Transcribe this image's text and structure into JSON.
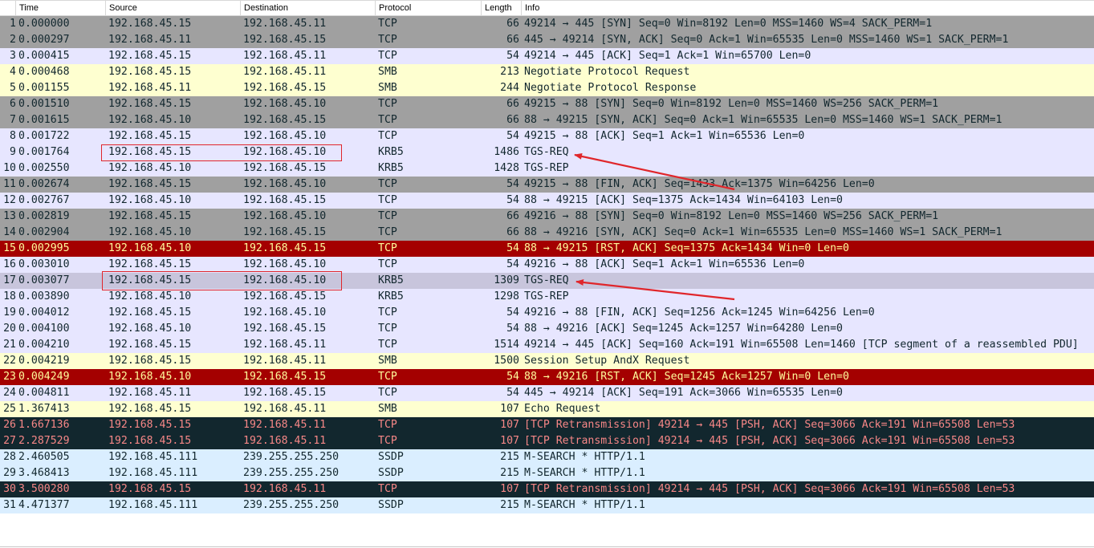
{
  "columns": {
    "no": "",
    "time": "Time",
    "source": "Source",
    "destination": "Destination",
    "protocol": "Protocol",
    "length": "Length",
    "info": "Info"
  },
  "packets": [
    {
      "no": "1",
      "time": "0.000000",
      "src": "192.168.45.15",
      "dst": "192.168.45.11",
      "proto": "TCP",
      "len": "66",
      "info": "49214 → 445 [SYN] Seq=0 Win=8192 Len=0 MSS=1460 WS=4 SACK_PERM=1",
      "style": "gray"
    },
    {
      "no": "2",
      "time": "0.000297",
      "src": "192.168.45.11",
      "dst": "192.168.45.15",
      "proto": "TCP",
      "len": "66",
      "info": "445 → 49214 [SYN, ACK] Seq=0 Ack=1 Win=65535 Len=0 MSS=1460 WS=1 SACK_PERM=1",
      "style": "gray"
    },
    {
      "no": "3",
      "time": "0.000415",
      "src": "192.168.45.15",
      "dst": "192.168.45.11",
      "proto": "TCP",
      "len": "54",
      "info": "49214 → 445 [ACK] Seq=1 Ack=1 Win=65700 Len=0",
      "style": "tcp"
    },
    {
      "no": "4",
      "time": "0.000468",
      "src": "192.168.45.15",
      "dst": "192.168.45.11",
      "proto": "SMB",
      "len": "213",
      "info": "Negotiate Protocol Request",
      "style": "smb"
    },
    {
      "no": "5",
      "time": "0.001155",
      "src": "192.168.45.11",
      "dst": "192.168.45.15",
      "proto": "SMB",
      "len": "244",
      "info": "Negotiate Protocol Response",
      "style": "smb"
    },
    {
      "no": "6",
      "time": "0.001510",
      "src": "192.168.45.15",
      "dst": "192.168.45.10",
      "proto": "TCP",
      "len": "66",
      "info": "49215 → 88 [SYN] Seq=0 Win=8192 Len=0 MSS=1460 WS=256 SACK_PERM=1",
      "style": "gray"
    },
    {
      "no": "7",
      "time": "0.001615",
      "src": "192.168.45.10",
      "dst": "192.168.45.15",
      "proto": "TCP",
      "len": "66",
      "info": "88 → 49215 [SYN, ACK] Seq=0 Ack=1 Win=65535 Len=0 MSS=1460 WS=1 SACK_PERM=1",
      "style": "gray"
    },
    {
      "no": "8",
      "time": "0.001722",
      "src": "192.168.45.15",
      "dst": "192.168.45.10",
      "proto": "TCP",
      "len": "54",
      "info": "49215 → 88 [ACK] Seq=1 Ack=1 Win=65536 Len=0",
      "style": "tcp"
    },
    {
      "no": "9",
      "time": "0.001764",
      "src": "192.168.45.15",
      "dst": "192.168.45.10",
      "proto": "KRB5",
      "len": "1486",
      "info": "TGS-REQ",
      "style": "tcp"
    },
    {
      "no": "10",
      "time": "0.002550",
      "src": "192.168.45.10",
      "dst": "192.168.45.15",
      "proto": "KRB5",
      "len": "1428",
      "info": "TGS-REP",
      "style": "tcp"
    },
    {
      "no": "11",
      "time": "0.002674",
      "src": "192.168.45.15",
      "dst": "192.168.45.10",
      "proto": "TCP",
      "len": "54",
      "info": "49215 → 88 [FIN, ACK] Seq=1433 Ack=1375 Win=64256 Len=0",
      "style": "gray"
    },
    {
      "no": "12",
      "time": "0.002767",
      "src": "192.168.45.10",
      "dst": "192.168.45.15",
      "proto": "TCP",
      "len": "54",
      "info": "88 → 49215 [ACK] Seq=1375 Ack=1434 Win=64103 Len=0",
      "style": "tcp"
    },
    {
      "no": "13",
      "time": "0.002819",
      "src": "192.168.45.15",
      "dst": "192.168.45.10",
      "proto": "TCP",
      "len": "66",
      "info": "49216 → 88 [SYN] Seq=0 Win=8192 Len=0 MSS=1460 WS=256 SACK_PERM=1",
      "style": "gray"
    },
    {
      "no": "14",
      "time": "0.002904",
      "src": "192.168.45.10",
      "dst": "192.168.45.15",
      "proto": "TCP",
      "len": "66",
      "info": "88 → 49216 [SYN, ACK] Seq=0 Ack=1 Win=65535 Len=0 MSS=1460 WS=1 SACK_PERM=1",
      "style": "gray"
    },
    {
      "no": "15",
      "time": "0.002995",
      "src": "192.168.45.10",
      "dst": "192.168.45.15",
      "proto": "TCP",
      "len": "54",
      "info": "88 → 49215 [RST, ACK] Seq=1375 Ack=1434 Win=0 Len=0",
      "style": "rst"
    },
    {
      "no": "16",
      "time": "0.003010",
      "src": "192.168.45.15",
      "dst": "192.168.45.10",
      "proto": "TCP",
      "len": "54",
      "info": "49216 → 88 [ACK] Seq=1 Ack=1 Win=65536 Len=0",
      "style": "tcp"
    },
    {
      "no": "17",
      "time": "0.003077",
      "src": "192.168.45.15",
      "dst": "192.168.45.10",
      "proto": "KRB5",
      "len": "1309",
      "info": "TGS-REQ",
      "style": "sel"
    },
    {
      "no": "18",
      "time": "0.003890",
      "src": "192.168.45.10",
      "dst": "192.168.45.15",
      "proto": "KRB5",
      "len": "1298",
      "info": "TGS-REP",
      "style": "tcp"
    },
    {
      "no": "19",
      "time": "0.004012",
      "src": "192.168.45.15",
      "dst": "192.168.45.10",
      "proto": "TCP",
      "len": "54",
      "info": "49216 → 88 [FIN, ACK] Seq=1256 Ack=1245 Win=64256 Len=0",
      "style": "tcp"
    },
    {
      "no": "20",
      "time": "0.004100",
      "src": "192.168.45.10",
      "dst": "192.168.45.15",
      "proto": "TCP",
      "len": "54",
      "info": "88 → 49216 [ACK] Seq=1245 Ack=1257 Win=64280 Len=0",
      "style": "tcp"
    },
    {
      "no": "21",
      "time": "0.004210",
      "src": "192.168.45.15",
      "dst": "192.168.45.11",
      "proto": "TCP",
      "len": "1514",
      "info": "49214 → 445 [ACK] Seq=160 Ack=191 Win=65508 Len=1460 [TCP segment of a reassembled PDU]",
      "style": "tcp"
    },
    {
      "no": "22",
      "time": "0.004219",
      "src": "192.168.45.15",
      "dst": "192.168.45.11",
      "proto": "SMB",
      "len": "1500",
      "info": "Session Setup AndX Request",
      "style": "smb"
    },
    {
      "no": "23",
      "time": "0.004249",
      "src": "192.168.45.10",
      "dst": "192.168.45.15",
      "proto": "TCP",
      "len": "54",
      "info": "88 → 49216 [RST, ACK] Seq=1245 Ack=1257 Win=0 Len=0",
      "style": "rst"
    },
    {
      "no": "24",
      "time": "0.004811",
      "src": "192.168.45.11",
      "dst": "192.168.45.15",
      "proto": "TCP",
      "len": "54",
      "info": "445 → 49214 [ACK] Seq=191 Ack=3066 Win=65535 Len=0",
      "style": "tcp"
    },
    {
      "no": "25",
      "time": "1.367413",
      "src": "192.168.45.15",
      "dst": "192.168.45.11",
      "proto": "SMB",
      "len": "107",
      "info": "Echo Request",
      "style": "smb"
    },
    {
      "no": "26",
      "time": "1.667136",
      "src": "192.168.45.15",
      "dst": "192.168.45.11",
      "proto": "TCP",
      "len": "107",
      "info": "[TCP Retransmission] 49214 → 445 [PSH, ACK] Seq=3066 Ack=191 Win=65508 Len=53",
      "style": "retx"
    },
    {
      "no": "27",
      "time": "2.287529",
      "src": "192.168.45.15",
      "dst": "192.168.45.11",
      "proto": "TCP",
      "len": "107",
      "info": "[TCP Retransmission] 49214 → 445 [PSH, ACK] Seq=3066 Ack=191 Win=65508 Len=53",
      "style": "retx"
    },
    {
      "no": "28",
      "time": "2.460505",
      "src": "192.168.45.111",
      "dst": "239.255.255.250",
      "proto": "SSDP",
      "len": "215",
      "info": "M-SEARCH * HTTP/1.1",
      "style": "ssdp"
    },
    {
      "no": "29",
      "time": "3.468413",
      "src": "192.168.45.111",
      "dst": "239.255.255.250",
      "proto": "SSDP",
      "len": "215",
      "info": "M-SEARCH * HTTP/1.1",
      "style": "ssdp"
    },
    {
      "no": "30",
      "time": "3.500280",
      "src": "192.168.45.15",
      "dst": "192.168.45.11",
      "proto": "TCP",
      "len": "107",
      "info": "[TCP Retransmission] 49214 → 445 [PSH, ACK] Seq=3066 Ack=191 Win=65508 Len=53",
      "style": "retx"
    },
    {
      "no": "31",
      "time": "4.471377",
      "src": "192.168.45.111",
      "dst": "239.255.255.250",
      "proto": "SSDP",
      "len": "215",
      "info": "M-SEARCH * HTTP/1.1",
      "style": "ssdp"
    }
  ],
  "annotation_color": "#e0262b"
}
